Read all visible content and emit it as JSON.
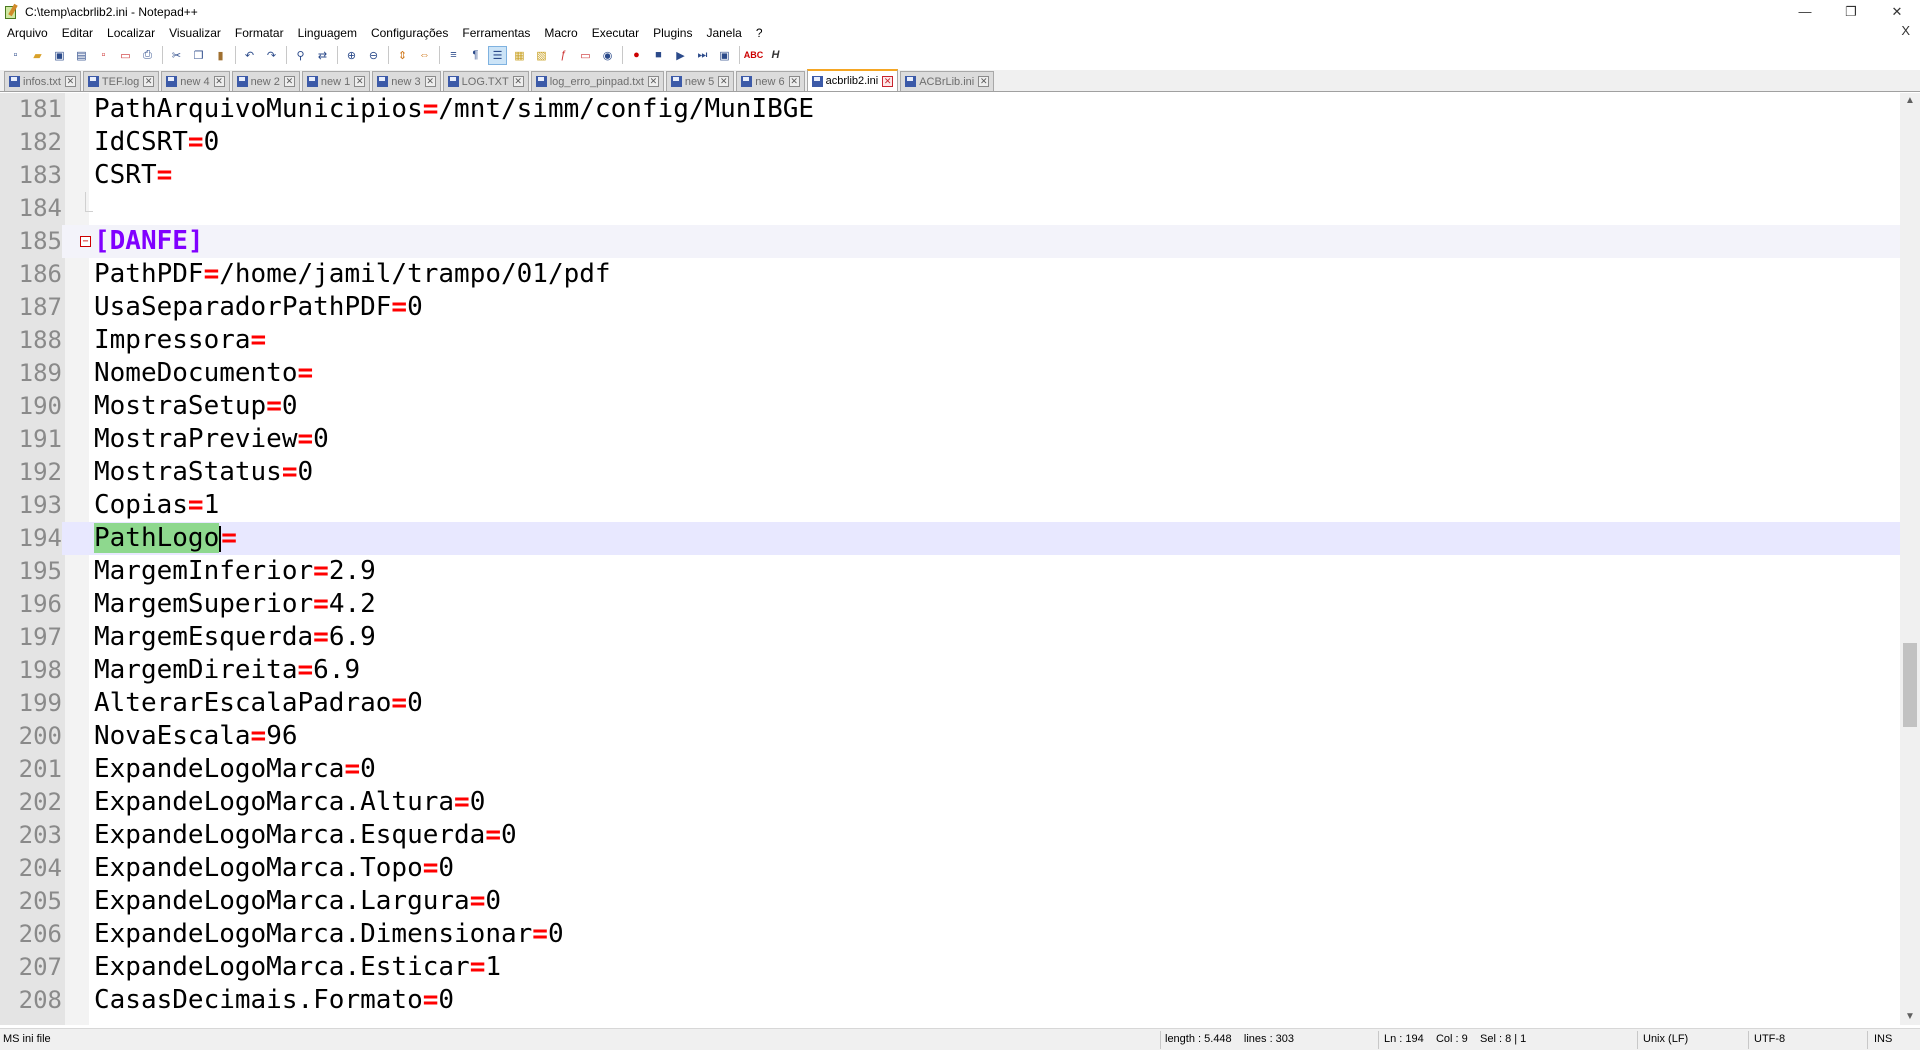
{
  "window": {
    "title": "C:\\temp\\acbrlib2.ini - Notepad++",
    "minimize": "—",
    "maximize": "❐",
    "close": "✕",
    "menu_close": "X"
  },
  "menu": [
    "Arquivo",
    "Editar",
    "Localizar",
    "Visualizar",
    "Formatar",
    "Linguagem",
    "Configurações",
    "Ferramentas",
    "Macro",
    "Executar",
    "Plugins",
    "Janela",
    "?"
  ],
  "tabs": [
    {
      "label": "infos.txt",
      "active": false
    },
    {
      "label": "TEF.log",
      "active": false
    },
    {
      "label": "new 4",
      "active": false
    },
    {
      "label": "new 2",
      "active": false
    },
    {
      "label": "new 1",
      "active": false
    },
    {
      "label": "new 3",
      "active": false
    },
    {
      "label": "LOG.TXT",
      "active": false
    },
    {
      "label": "log_erro_pinpad.txt",
      "active": false
    },
    {
      "label": "new 5",
      "active": false
    },
    {
      "label": "new 6",
      "active": false
    },
    {
      "label": "acbrlib2.ini",
      "active": true
    },
    {
      "label": "ACBrLib.ini",
      "active": false
    }
  ],
  "editor": {
    "lines": [
      {
        "n": "181",
        "key": "PathArquivoMunicipios",
        "eq": "=",
        "val": "/mnt/simm/config/MunIBGE"
      },
      {
        "n": "182",
        "key": "IdCSRT",
        "eq": "=",
        "val": "0"
      },
      {
        "n": "183",
        "key": "CSRT",
        "eq": "=",
        "val": ""
      },
      {
        "n": "184",
        "key": "",
        "eq": "",
        "val": ""
      },
      {
        "n": "185",
        "section": "[DANFE]"
      },
      {
        "n": "186",
        "key": "PathPDF",
        "eq": "=",
        "val": "/home/jamil/trampo/01/pdf"
      },
      {
        "n": "187",
        "key": "UsaSeparadorPathPDF",
        "eq": "=",
        "val": "0"
      },
      {
        "n": "188",
        "key": "Impressora",
        "eq": "=",
        "val": ""
      },
      {
        "n": "189",
        "key": "NomeDocumento",
        "eq": "=",
        "val": ""
      },
      {
        "n": "190",
        "key": "MostraSetup",
        "eq": "=",
        "val": "0"
      },
      {
        "n": "191",
        "key": "MostraPreview",
        "eq": "=",
        "val": "0"
      },
      {
        "n": "192",
        "key": "MostraStatus",
        "eq": "=",
        "val": "0"
      },
      {
        "n": "193",
        "key": "Copias",
        "eq": "=",
        "val": "1"
      },
      {
        "n": "194",
        "key": "PathLogo",
        "eq": "=",
        "val": "",
        "current": true
      },
      {
        "n": "195",
        "key": "MargemInferior",
        "eq": "=",
        "val": "2.9"
      },
      {
        "n": "196",
        "key": "MargemSuperior",
        "eq": "=",
        "val": "4.2"
      },
      {
        "n": "197",
        "key": "MargemEsquerda",
        "eq": "=",
        "val": "6.9"
      },
      {
        "n": "198",
        "key": "MargemDireita",
        "eq": "=",
        "val": "6.9"
      },
      {
        "n": "199",
        "key": "AlterarEscalaPadrao",
        "eq": "=",
        "val": "0"
      },
      {
        "n": "200",
        "key": "NovaEscala",
        "eq": "=",
        "val": "96"
      },
      {
        "n": "201",
        "key": "ExpandeLogoMarca",
        "eq": "=",
        "val": "0"
      },
      {
        "n": "202",
        "key": "ExpandeLogoMarca.Altura",
        "eq": "=",
        "val": "0"
      },
      {
        "n": "203",
        "key": "ExpandeLogoMarca.Esquerda",
        "eq": "=",
        "val": "0"
      },
      {
        "n": "204",
        "key": "ExpandeLogoMarca.Topo",
        "eq": "=",
        "val": "0"
      },
      {
        "n": "205",
        "key": "ExpandeLogoMarca.Largura",
        "eq": "=",
        "val": "0"
      },
      {
        "n": "206",
        "key": "ExpandeLogoMarca.Dimensionar",
        "eq": "=",
        "val": "0"
      },
      {
        "n": "207",
        "key": "ExpandeLogoMarca.Esticar",
        "eq": "=",
        "val": "1"
      },
      {
        "n": "208",
        "key": "CasasDecimais.Formato",
        "eq": "=",
        "val": "0"
      }
    ],
    "fold_marker": "⊟"
  },
  "status": {
    "file_type": "MS ini file",
    "length_lines": "length : 5.448    lines : 303",
    "position": "Ln : 194    Col : 9    Sel : 8 | 1",
    "eol": "Unix (LF)",
    "encoding": "UTF-8",
    "mode": "INS"
  },
  "colors": {
    "section": "#8000ff",
    "operator": "#ff0000",
    "current_line": "#e8e8ff",
    "smart_highlight": "#8ed88e",
    "active_tab_accent": "#f5a623"
  }
}
